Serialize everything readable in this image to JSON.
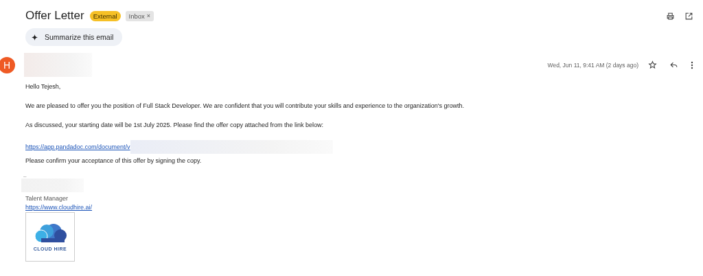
{
  "subject": "Offer Letter",
  "labels": [
    {
      "text": "External",
      "kind": "warning"
    },
    {
      "text": "Inbox",
      "kind": "removable",
      "remove": "×"
    }
  ],
  "summarize_button": "Summarize this email",
  "sender": {
    "avatar": "H",
    "redacted": true
  },
  "date": "Wed, Jun 11, 9:41 AM (2 days ago)",
  "starred": false,
  "body": [
    {
      "kind": "text",
      "text": "Hello Tejesh,"
    },
    {
      "kind": "text",
      "text": "We are pleased to offer you the position of Full Stack Developer. We are confident that you will contribute your skills and experience to the organization's growth."
    },
    {
      "kind": "text",
      "text": "As discussed, your starting date will be 1st July 2025. Please find the offer copy attached from the link below:"
    },
    {
      "kind": "link",
      "text": "https://app.pandadoc.com/document/v",
      "redacted": true
    },
    {
      "kind": "tight",
      "text": "Please confirm your acceptance of this offer by signing the copy."
    }
  ],
  "signature": {
    "separator": "--",
    "name_redacted": true,
    "title": "Talent Manager",
    "link": "https://www.cloudhire.ai/",
    "logo_text": "CLOUD HIRE"
  }
}
